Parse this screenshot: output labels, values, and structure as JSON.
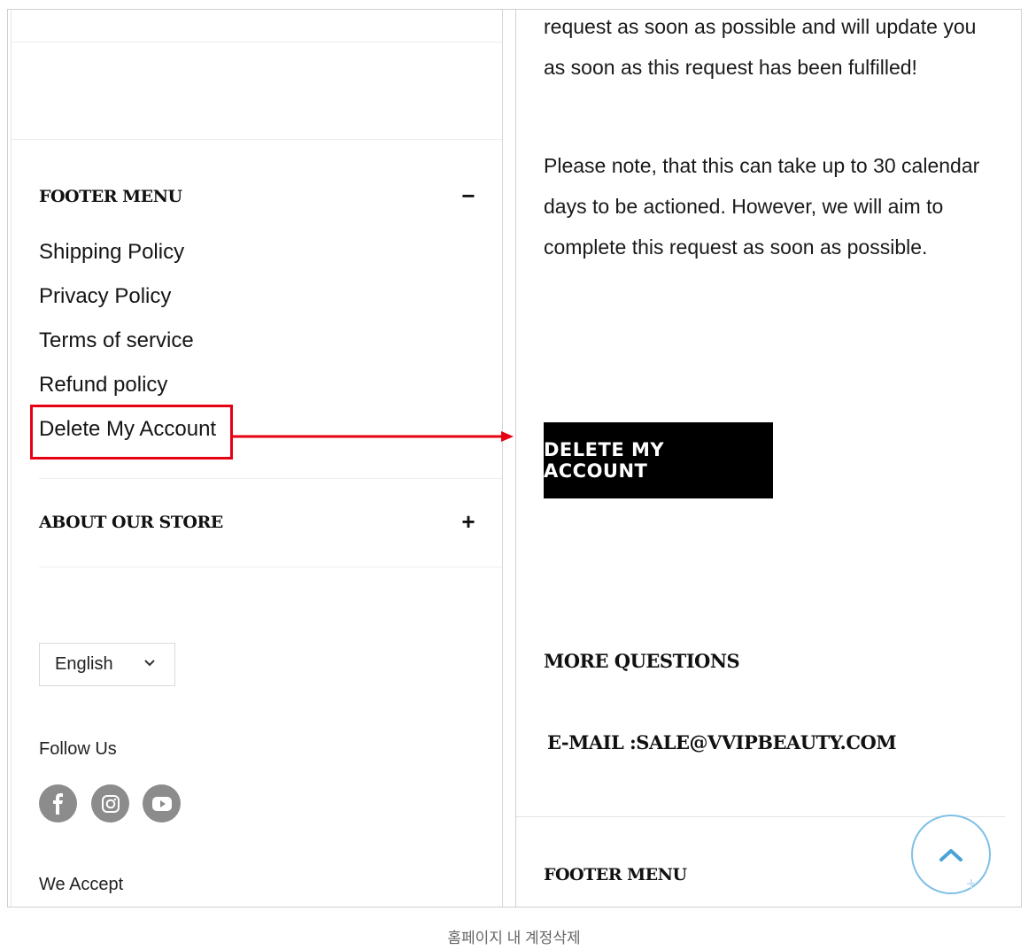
{
  "left_panel": {
    "footer_menu": {
      "title": "FOOTER MENU",
      "toggle": "−",
      "links": [
        "Shipping Policy",
        "Privacy Policy",
        "Terms of service",
        "Refund policy",
        "Delete My Account"
      ]
    },
    "about_store": {
      "title": "ABOUT OUR STORE",
      "toggle": "+"
    },
    "language": {
      "selected": "English"
    },
    "follow_us_label": "Follow Us",
    "social_icons": [
      "facebook-icon",
      "instagram-icon",
      "youtube-icon"
    ],
    "we_accept_label": "We Accept"
  },
  "right_panel": {
    "paragraph_1": "request as soon as possible and will update you as soon as this request has been fulfilled!",
    "paragraph_2": "Please note, that this can take up to 30 calendar days to be actioned. However, we will aim to complete this request as soon as possible.",
    "delete_button_label": "DELETE MY ACCOUNT",
    "more_questions_heading": "MORE QUESTIONS",
    "email_line": "E-MAIL :SALE@VVIPBEAUTY.COM",
    "footer_menu_title": "FOOTER MENU"
  },
  "annotation": {
    "highlight_color": "#e60012",
    "caption": "홈페이지 내 계정삭제"
  },
  "colors": {
    "accent_ring": "#7fc0e6",
    "social_bg": "#8c8c8c"
  }
}
